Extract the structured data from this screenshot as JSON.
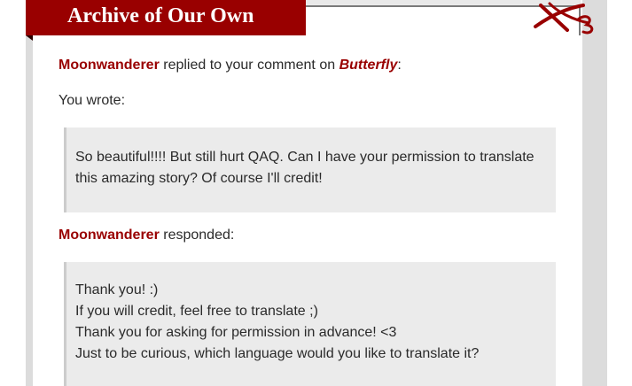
{
  "site": {
    "title": "Archive of Our Own",
    "logo_icon": "ao3-logo-icon",
    "brand_color": "#990000"
  },
  "notification": {
    "commenter": "Moonwanderer",
    "replied_text": " replied to your comment on ",
    "work_title": "Butterfly",
    "work_suffix": ":",
    "you_wrote_label": "You wrote:",
    "your_comment_lines": [
      "So beautiful!!!! But still hurt QAQ. Can I have your permission to translate",
      "this amazing story? Of course I'll credit!"
    ],
    "responder": "Moonwanderer",
    "responded_label": " responded:",
    "reply_lines": [
      "Thank you! :)",
      "If you will credit, feel free to translate ;)",
      "Thank you for asking for permission in advance! <3",
      "Just to be curious, which language would you like to translate it?"
    ]
  }
}
